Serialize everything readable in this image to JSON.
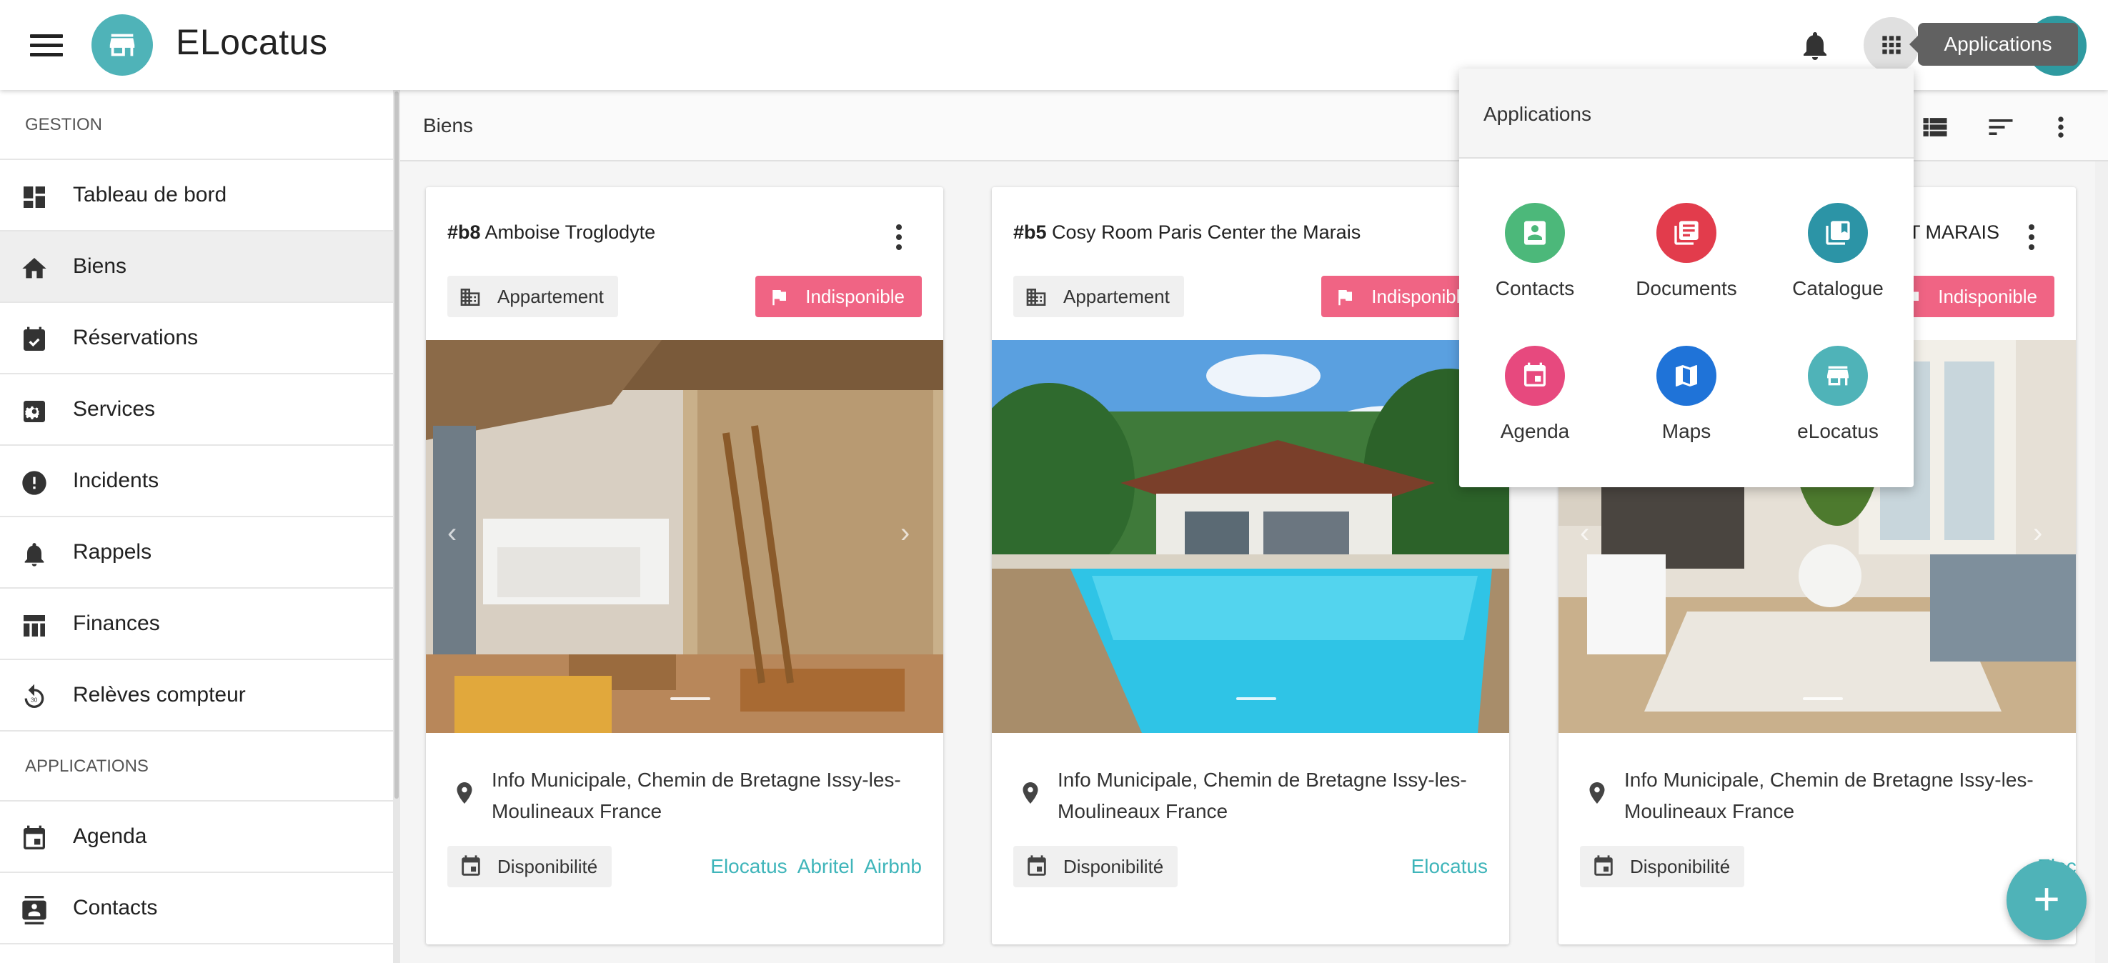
{
  "header": {
    "app_title": "ELocatus",
    "tooltip": "Applications",
    "icons": [
      "menu-icon",
      "storefront-icon",
      "bell-icon",
      "apps-grid-icon"
    ]
  },
  "sidebar": {
    "section_gestion": "GESTION",
    "items": [
      {
        "label": "Tableau de bord",
        "icon": "dashboard-icon"
      },
      {
        "label": "Biens",
        "icon": "home-icon"
      },
      {
        "label": "Réservations",
        "icon": "event-note-icon"
      },
      {
        "label": "Services",
        "icon": "settings-box-icon"
      },
      {
        "label": "Incidents",
        "icon": "alert-circle-icon"
      },
      {
        "label": "Rappels",
        "icon": "bell-icon"
      },
      {
        "label": "Finances",
        "icon": "table-icon"
      },
      {
        "label": "Relèves compteur",
        "icon": "refresh-icon"
      }
    ],
    "section_applications": "APPLICATIONS",
    "app_items": [
      {
        "label": "Agenda",
        "icon": "calendar-icon"
      },
      {
        "label": "Contacts",
        "icon": "contacts-icon"
      }
    ]
  },
  "toolbar": {
    "title": "Biens",
    "icons": [
      "list-view-icon",
      "sort-icon",
      "more-vert-icon"
    ]
  },
  "cards": [
    {
      "id": "#b8",
      "name": "Amboise Troglodyte",
      "type_label": "Appartement",
      "status": "Indisponible",
      "address": "Info Municipale, Chemin de Bretagne Issy-les-Moulineaux France",
      "dispo_label": "Disponibilité",
      "links": [
        "Elocatus",
        "Abritel",
        "Airbnb"
      ]
    },
    {
      "id": "#b5",
      "name": "Cosy Room Paris Center the Marais",
      "type_label": "Appartement",
      "status": "Indisponible",
      "address": "Info Municipale, Chemin de Bretagne Issy-les-Moulineaux France",
      "dispo_label": "Disponibilité",
      "links": [
        "Elocatus"
      ]
    },
    {
      "id": "",
      "name": "T MARAIS",
      "type_label": "",
      "status": "Indisponible",
      "address": "Info Municipale, Chemin de Bretagne Issy-les-Moulineaux France",
      "dispo_label": "Disponibilité",
      "links": [
        "Elocat"
      ]
    }
  ],
  "apps_popup": {
    "title": "Applications",
    "apps": [
      {
        "label": "Contacts",
        "color": "#4cb87a",
        "icon": "contacts-icon"
      },
      {
        "label": "Documents",
        "color": "#e23c4c",
        "icon": "documents-icon"
      },
      {
        "label": "Catalogue",
        "color": "#2c94a6",
        "icon": "catalogue-icon"
      },
      {
        "label": "Agenda",
        "color": "#e7497e",
        "icon": "calendar-icon"
      },
      {
        "label": "Maps",
        "color": "#1f73d8",
        "icon": "map-icon"
      },
      {
        "label": "eLocatus",
        "color": "#4fb3b8",
        "icon": "storefront-icon"
      }
    ]
  },
  "fab": {
    "label": "+"
  },
  "colors": {
    "accent": "#4fb3b8",
    "status_red": "#f06484",
    "link": "#3fb5ba"
  }
}
